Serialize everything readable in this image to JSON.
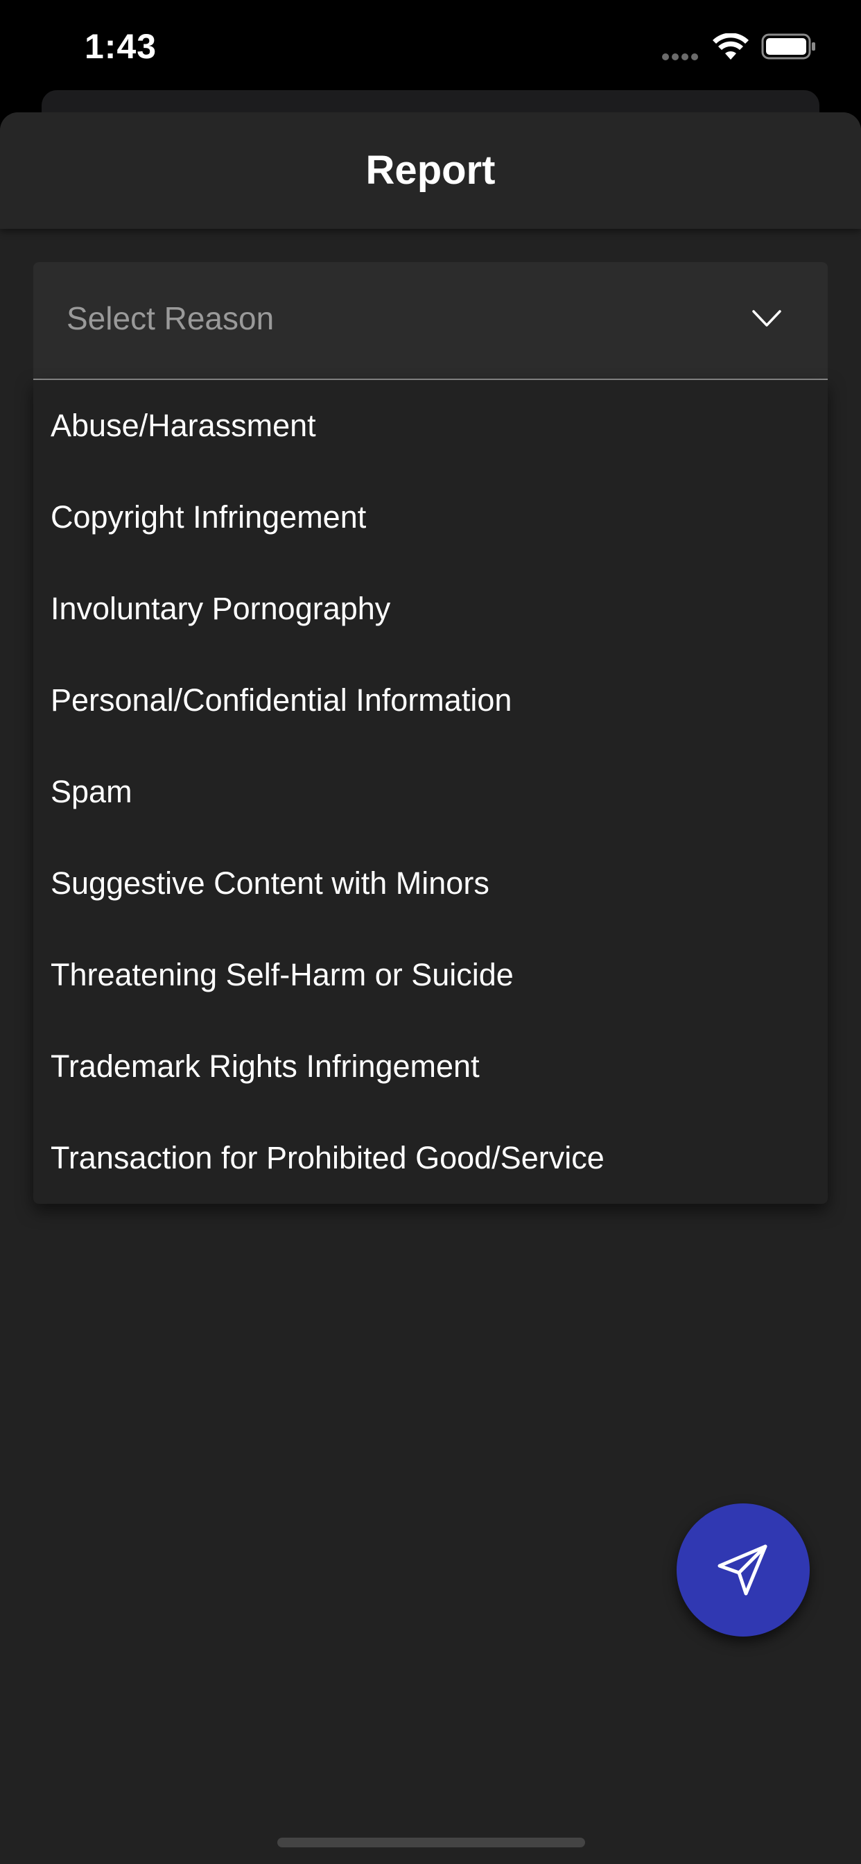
{
  "status_bar": {
    "time": "1:43"
  },
  "sheet": {
    "title": "Report"
  },
  "select": {
    "placeholder": "Select Reason"
  },
  "menu": {
    "items": [
      "Abuse/Harassment",
      "Copyright Infringement",
      "Involuntary Pornography",
      "Personal/Confidential Information",
      "Spam",
      "Suggestive Content with Minors",
      "Threatening Self-Harm or Suicide",
      "Trademark Rights Infringement",
      "Transaction for Prohibited Good/Service"
    ]
  },
  "icons": {
    "wifi": "wifi-icon",
    "battery": "battery-icon",
    "chevron": "chevron-down-icon",
    "send": "send-icon"
  },
  "colors": {
    "background": "#222222",
    "fab": "#3038b2",
    "text": "#ffffff",
    "placeholder": "#9a9a9a"
  }
}
